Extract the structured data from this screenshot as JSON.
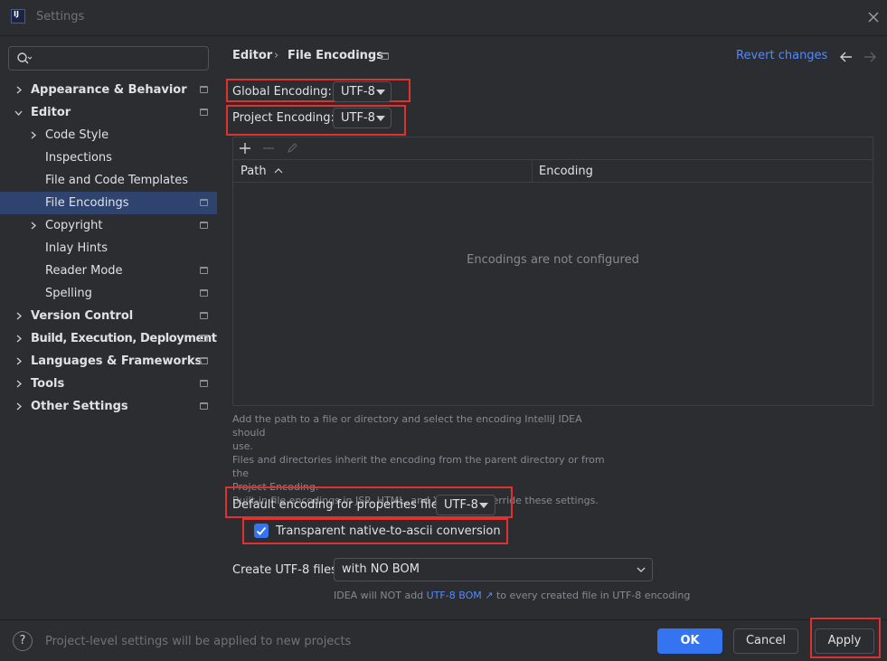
{
  "window": {
    "title": "Settings",
    "app_icon_text": "IJ"
  },
  "search": {
    "placeholder": ""
  },
  "sidebar": {
    "items": [
      {
        "label": "Appearance & Behavior"
      },
      {
        "label": "Editor"
      },
      {
        "label": "Code Style"
      },
      {
        "label": "Inspections"
      },
      {
        "label": "File and Code Templates"
      },
      {
        "label": "File Encodings"
      },
      {
        "label": "Copyright"
      },
      {
        "label": "Inlay Hints"
      },
      {
        "label": "Reader Mode"
      },
      {
        "label": "Spelling"
      },
      {
        "label": "Version Control"
      },
      {
        "label": "Build, Execution, Deployment"
      },
      {
        "label": "Languages & Frameworks"
      },
      {
        "label": "Tools"
      },
      {
        "label": "Other Settings"
      }
    ]
  },
  "breadcrumb": {
    "parent": "Editor",
    "separator": "›",
    "current": "File Encodings"
  },
  "header": {
    "revert_label": "Revert changes"
  },
  "global_encoding": {
    "label": "Global Encoding:",
    "value": "UTF-8"
  },
  "project_encoding": {
    "label": "Project Encoding:",
    "value": "UTF-8"
  },
  "table": {
    "columns": [
      "Path",
      "Encoding"
    ],
    "sort_indicator": "^",
    "empty_text": "Encodings are not configured"
  },
  "help": {
    "lines": [
      "Add the path to a file or directory and select the encoding IntelliJ IDEA should",
      "use.",
      "Files and directories inherit the encoding from the parent directory or from the",
      "Project Encoding.",
      "Built-in file encodings in JSP, HTML, and XML files override these settings."
    ]
  },
  "properties_encoding": {
    "label": "Default encoding for properties files:",
    "value": "UTF-8"
  },
  "native_to_ascii": {
    "label": "Transparent native-to-ascii conversion",
    "checked": true
  },
  "create_utf8": {
    "label": "Create UTF-8 files:",
    "value": "with NO BOM"
  },
  "bom_note": {
    "prefix": "IDEA will NOT add",
    "link": "UTF-8 BOM",
    "suffix": "to every created file in UTF-8 encoding"
  },
  "footer": {
    "help_glyph": "?",
    "status": "Project-level settings will be applied to new projects",
    "ok_label": "OK",
    "cancel_label": "Cancel",
    "apply_label": "Apply"
  },
  "colors": {
    "background": "#2b2d30",
    "selection": "#2e436e",
    "accent": "#3574f0",
    "link": "#548af7",
    "highlight_box": "#e03131"
  }
}
